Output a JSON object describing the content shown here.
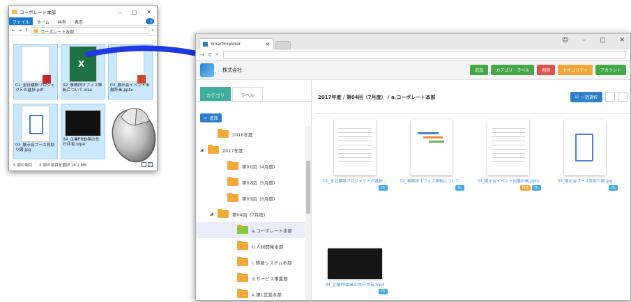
{
  "explorer": {
    "title": "コーポレート本部",
    "ribbon": [
      "ファイル",
      "ホーム",
      "共有",
      "表示"
    ],
    "address": [
      "コーポレート本部"
    ],
    "files": [
      {
        "name": "01_全社横断プロジェクトの進捗.pdf",
        "type": "pdf"
      },
      {
        "name": "02_事務所オフィス移転について.xlsx",
        "type": "xlsx"
      },
      {
        "name": "03_展示会イベント出展計画.pptx",
        "type": "pptx"
      },
      {
        "name": "03_展示会ブース見取り図.jpg",
        "type": "jpg"
      },
      {
        "name": "04_企業PR動画の先行共有.mp4",
        "type": "mp4"
      }
    ],
    "status": [
      "5 個の項目",
      "5 個の項目を選択 18.2 MB"
    ]
  },
  "app": {
    "tab_title": "SmartExplorer",
    "company": "株式会社",
    "buttons": [
      {
        "label": "追加",
        "color": "#43a847"
      },
      {
        "label": "カテゴリ・ラベル",
        "color": "#43a847"
      },
      {
        "label": "削除",
        "color": "#d9534f"
      },
      {
        "label": "セキュリティ",
        "color": "#f0a73a"
      },
      {
        "label": "アカウント",
        "color": "#43a847"
      }
    ],
    "side_tabs": [
      "カテゴリ",
      "ラベル"
    ],
    "add_label": "追加",
    "tree": [
      {
        "label": "2016年度",
        "indent": 1,
        "tri": ""
      },
      {
        "label": "2017年度",
        "indent": 0,
        "tri": "◢"
      },
      {
        "label": "第01回（4月度）",
        "indent": 2,
        "tri": ""
      },
      {
        "label": "第02回（5月度）",
        "indent": 2,
        "tri": ""
      },
      {
        "label": "第03回（6月度）",
        "indent": 2,
        "tri": ""
      },
      {
        "label": "第04回（7月度）",
        "indent": 1,
        "tri": "◢"
      },
      {
        "label": "a.コーポレート本部",
        "indent": 3,
        "tri": "",
        "selected": true
      },
      {
        "label": "b.人材開発本部",
        "indent": 3,
        "tri": ""
      },
      {
        "label": "c.情報システム本部",
        "indent": 3,
        "tri": ""
      },
      {
        "label": "d.サービス事業部",
        "indent": 3,
        "tri": ""
      },
      {
        "label": "e.第1営業本部",
        "indent": 3,
        "tri": ""
      }
    ],
    "breadcrumb": "2017年度 / 第04回（7月度） / a.コーポレート本部",
    "select_all": "一括選択",
    "files": [
      {
        "label": "01_全社横断プロジェクトの進捗…",
        "tags": [
          "DL"
        ],
        "kind": "doc"
      },
      {
        "label": "02_事務所オフィス移転について…",
        "tags": [
          "DL"
        ],
        "kind": "chart"
      },
      {
        "label": "03_展示会イベント出展計画.pptx",
        "tags": [
          "PDF",
          "DL"
        ],
        "kind": "doc"
      },
      {
        "label": "03_展示会ブース見取り図.jpg",
        "tags": [
          "DL"
        ],
        "kind": "plan"
      },
      {
        "label": "04_企業PR動画の先行共有.mp4",
        "tags": [
          "DL"
        ],
        "kind": "video"
      }
    ]
  }
}
